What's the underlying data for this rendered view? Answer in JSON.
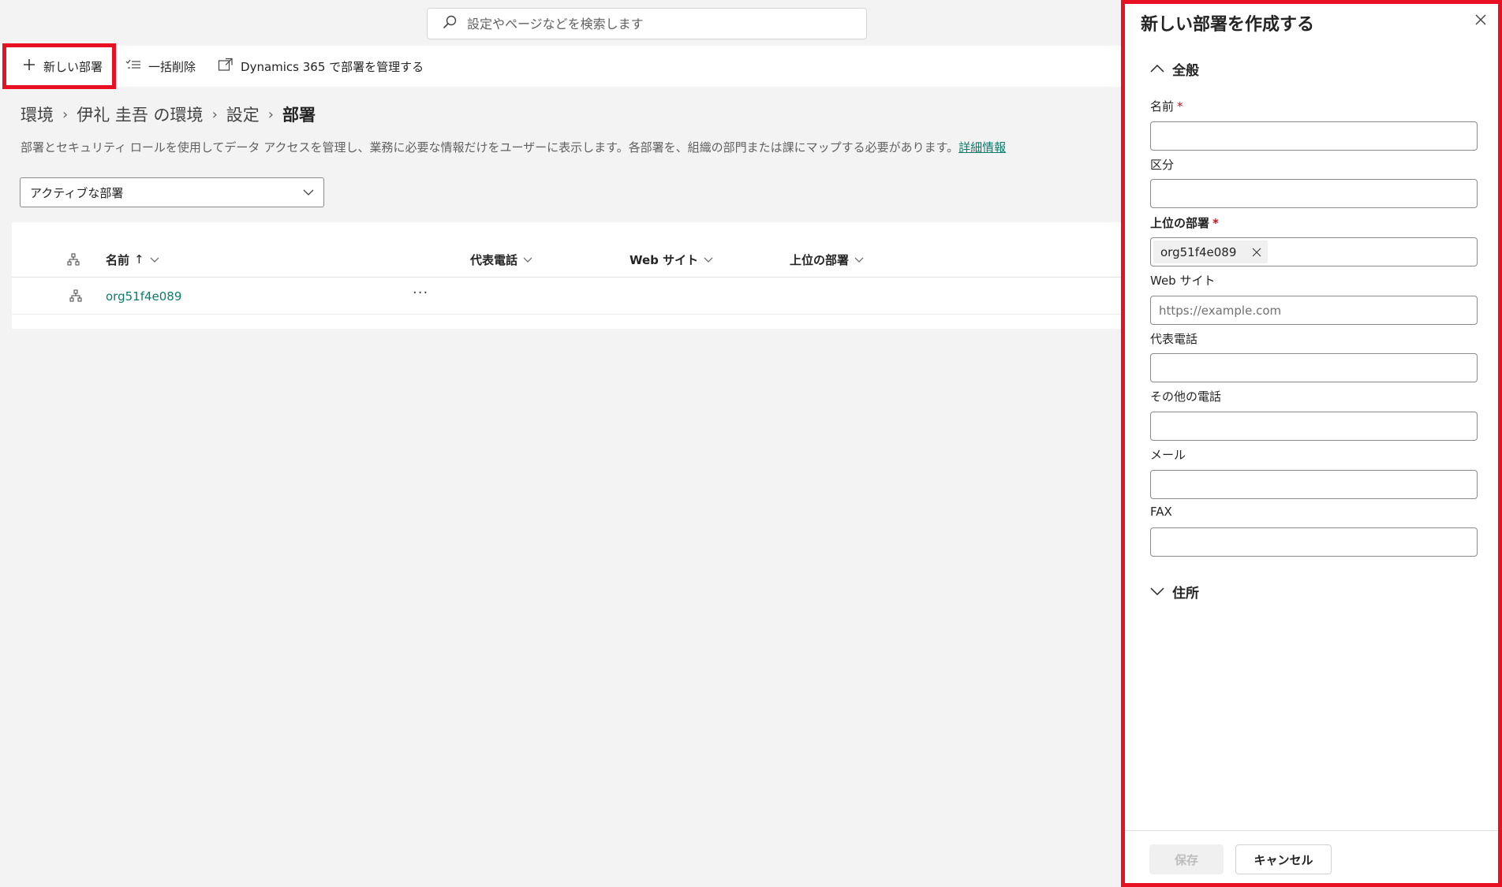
{
  "search": {
    "placeholder": "設定やページなどを検索します"
  },
  "commands": {
    "new": "新しい部署",
    "bulk_delete": "一括削除",
    "manage": "Dynamics 365 で部署を管理する"
  },
  "breadcrumb": {
    "items": [
      "環境",
      "伊礼 圭吾 の環境",
      "設定"
    ],
    "current": "部署"
  },
  "description": {
    "text": "部署とセキュリティ ロールを使用してデータ アクセスを管理し、業務に必要な情報だけをユーザーに表示します。各部署を、組織の部門または課にマップする必要があります。",
    "link": "詳細情報"
  },
  "filter": {
    "selected": "アクティブな部署"
  },
  "grid": {
    "columns": {
      "name": "名前",
      "name_sort": "↑",
      "phone": "代表電話",
      "website": "Web サイト",
      "parent": "上位の部署"
    },
    "rows": [
      {
        "name": "org51f4e089",
        "more": "···"
      }
    ]
  },
  "panel": {
    "title": "新しい部署を作成する",
    "section_general": "全般",
    "section_address": "住所",
    "fields": {
      "name": {
        "label": "名前",
        "required": "*",
        "value": ""
      },
      "division": {
        "label": "区分",
        "value": ""
      },
      "parent": {
        "label": "上位の部署",
        "required": "*",
        "value": "org51f4e089"
      },
      "website": {
        "label": "Web サイト",
        "placeholder": "https://example.com",
        "value": ""
      },
      "main_phone": {
        "label": "代表電話",
        "value": ""
      },
      "other_phone": {
        "label": "その他の電話",
        "value": ""
      },
      "email": {
        "label": "メール",
        "value": ""
      },
      "fax": {
        "label": "FAX",
        "value": ""
      }
    },
    "buttons": {
      "save": "保存",
      "cancel": "キャンセル"
    }
  },
  "colors": {
    "highlight": "#e81123",
    "link": "#0e7a6b",
    "required": "#c50f1f"
  }
}
